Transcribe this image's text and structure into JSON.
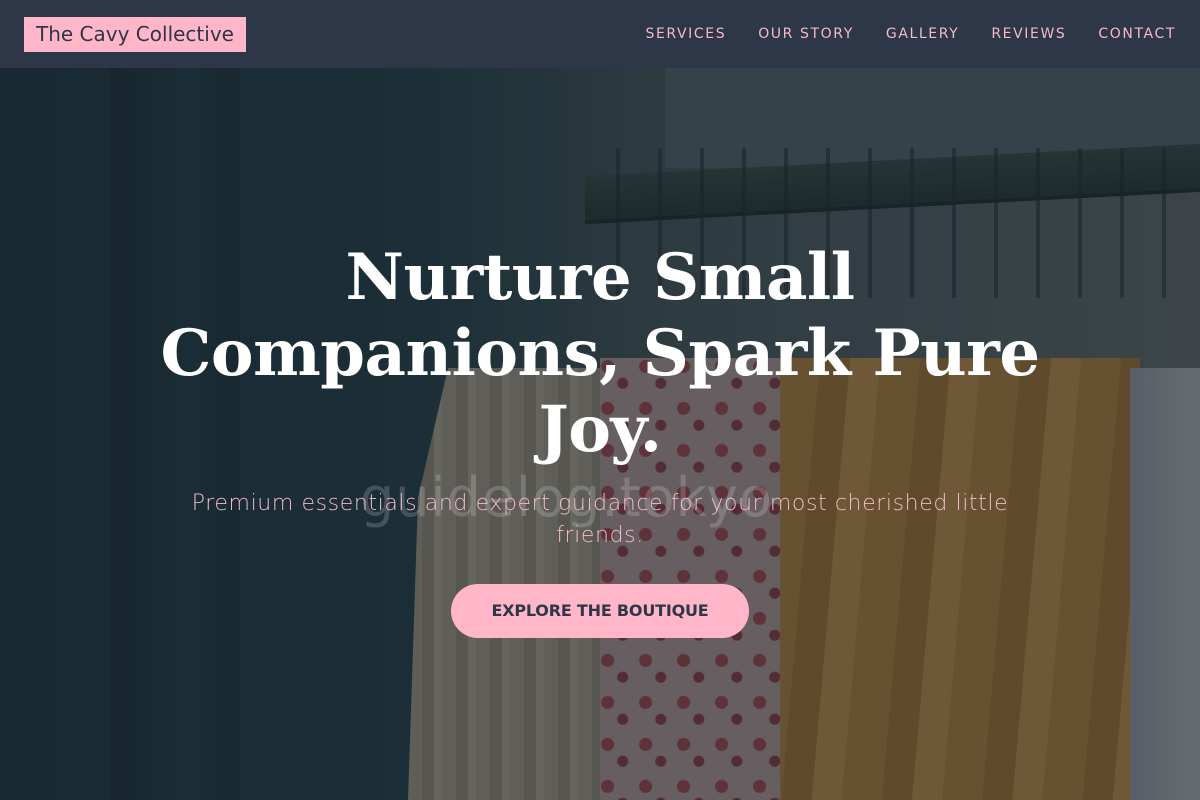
{
  "brand": {
    "name": "The Cavy Collective"
  },
  "nav": {
    "items": [
      {
        "label": "SERVICES"
      },
      {
        "label": "OUR STORY"
      },
      {
        "label": "GALLERY"
      },
      {
        "label": "REVIEWS"
      },
      {
        "label": "CONTACT"
      }
    ]
  },
  "hero": {
    "headline": "Nurture Small Companions, Spark Pure Joy.",
    "subheadline": "Premium essentials and expert guidance for your most cherished little friends.",
    "cta_label": "EXPLORE THE BOUTIQUE",
    "watermark": "guidelog.tokyo"
  },
  "colors": {
    "header_bg": "#2d3748",
    "accent_pink": "#ffb6c8",
    "nav_text": "#f4b9c8"
  }
}
